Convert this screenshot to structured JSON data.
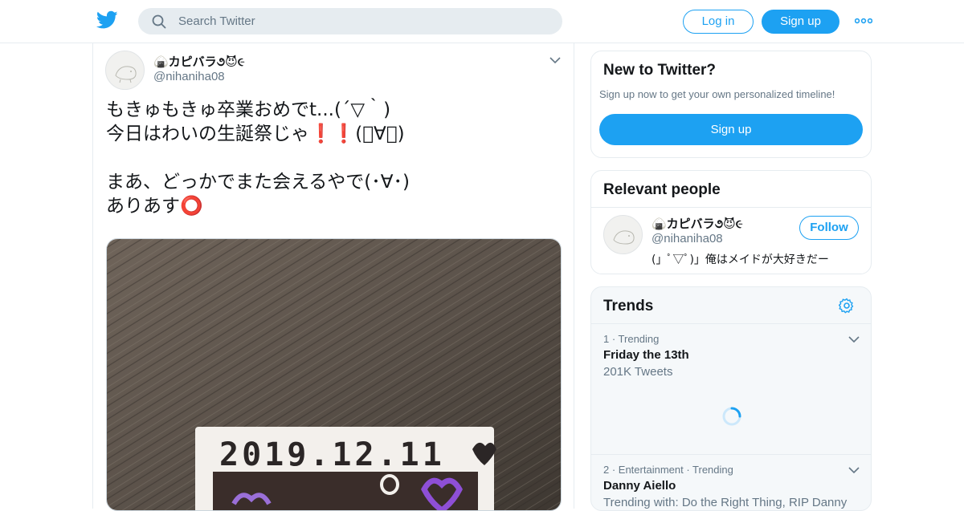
{
  "header": {
    "search_placeholder": "Search Twitter",
    "login_label": "Log in",
    "signup_label": "Sign up"
  },
  "tweet": {
    "display_name": "🍙カピバラ૭😈૯",
    "handle": "@nihaniha08",
    "text": "もきゅもきゅ卒業おめでt...(´▽｀)\n今日はわいの生誕祭じゃ❗❗(ﾟ∀｡)\n\nまあ、どっかでまた会えるやで(･∀･)\nありあす⭕",
    "photo_caption": "2019.12.11"
  },
  "new_to_twitter": {
    "title": "New to Twitter?",
    "subtitle": "Sign up now to get your own personalized timeline!",
    "button_label": "Sign up"
  },
  "relevant_people": {
    "title": "Relevant people",
    "person": {
      "display_name": "🍙カピバラ૭😈૯",
      "handle": "@nihaniha08",
      "bio": "(」ﾟ▽ﾟ)」俺はメイドが大好きだー",
      "follow_label": "Follow"
    }
  },
  "trends": {
    "title": "Trends",
    "items": [
      {
        "meta": "1 · Trending",
        "name": "Friday the 13th",
        "sub": "201K Tweets"
      },
      {
        "meta": "2 · Entertainment · Trending",
        "name": "Danny Aiello",
        "sub": "Trending with: Do the Right Thing, RIP Danny"
      }
    ]
  },
  "colors": {
    "brand_blue": "#1da1f2",
    "muted_text": "#657786",
    "border": "#e6ecf0"
  }
}
